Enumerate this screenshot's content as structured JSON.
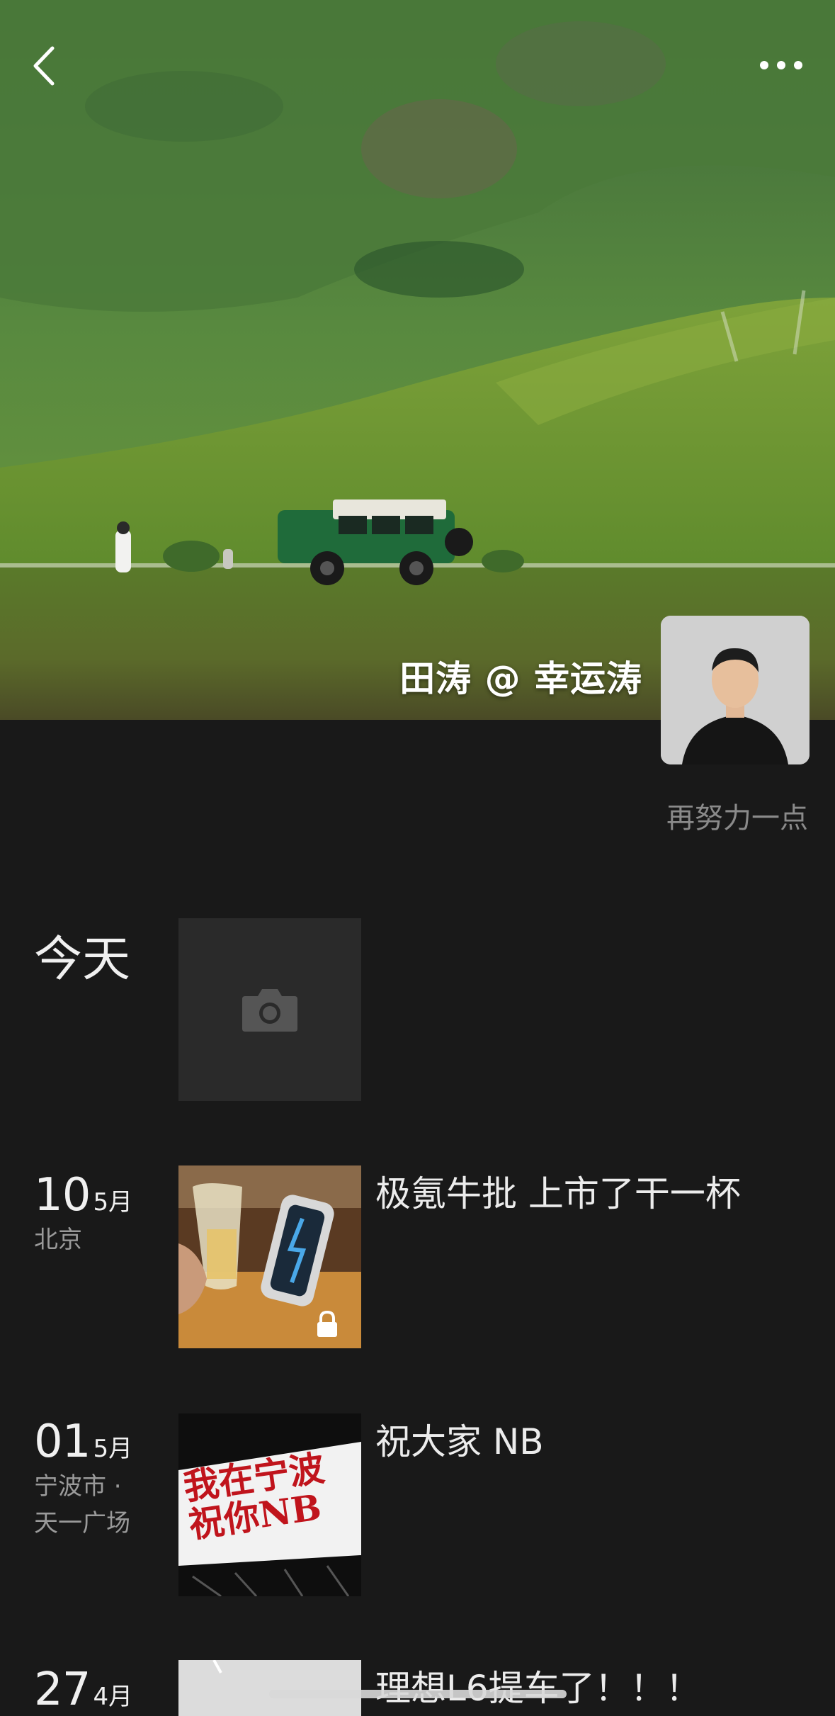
{
  "profile": {
    "name": "田涛 @ 幸运涛",
    "signature": "再努力一点"
  },
  "moments": [
    {
      "day": "今天",
      "type": "camera"
    },
    {
      "day": "10",
      "month": "5月",
      "location_lines": [
        "北京"
      ],
      "text": "极氪牛批  上市了干一杯",
      "locked": true
    },
    {
      "day": "01",
      "month": "5月",
      "location_lines": [
        "宁波市 ·",
        "天一广场"
      ],
      "text": "祝大家 NB",
      "image_text": [
        "我在宁波",
        "祝你NB"
      ]
    },
    {
      "day": "27",
      "month": "4月",
      "location_lines": [],
      "text": "理想L6提车了！！！"
    }
  ],
  "icons": {
    "back": "chevron-left-icon",
    "more": "more-dots-icon",
    "camera": "camera-icon",
    "lock": "lock-icon"
  },
  "colors": {
    "background": "#191919",
    "tile": "#2a2a2a",
    "secondary_text": "#8a8a8a"
  }
}
